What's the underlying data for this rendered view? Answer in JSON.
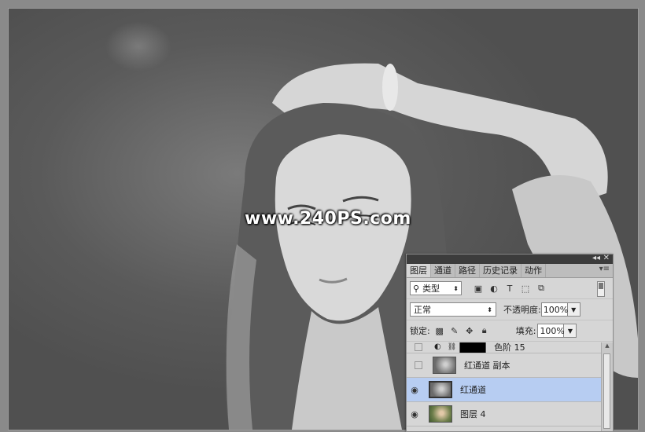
{
  "watermark": "www.240PS.com",
  "panel": {
    "tabs": [
      {
        "label": "图层",
        "active": true
      },
      {
        "label": "通道",
        "active": false
      },
      {
        "label": "路径",
        "active": false
      },
      {
        "label": "历史记录",
        "active": false
      },
      {
        "label": "动作",
        "active": false
      }
    ],
    "filter_kind": "类型",
    "blend_mode": "正常",
    "opacity_label": "不透明度:",
    "opacity_value": "100%",
    "lock_label": "锁定:",
    "fill_label": "填充:",
    "fill_value": "100%",
    "icons": {
      "collapse": "collapse-icon",
      "close": "close-icon",
      "menu": "panel-menu-icon"
    },
    "layers": [
      {
        "name": "色阶 15",
        "visible": false,
        "type": "adjustment"
      },
      {
        "name": "红通道 副本",
        "visible": false,
        "type": "gray"
      },
      {
        "name": "红通道",
        "visible": true,
        "type": "gray",
        "selected": true
      },
      {
        "name": "图层 4",
        "visible": true,
        "type": "color"
      }
    ]
  },
  "colors": {
    "selected_layer": "#b7cdf2",
    "panel_bg": "#d6d6d6"
  }
}
